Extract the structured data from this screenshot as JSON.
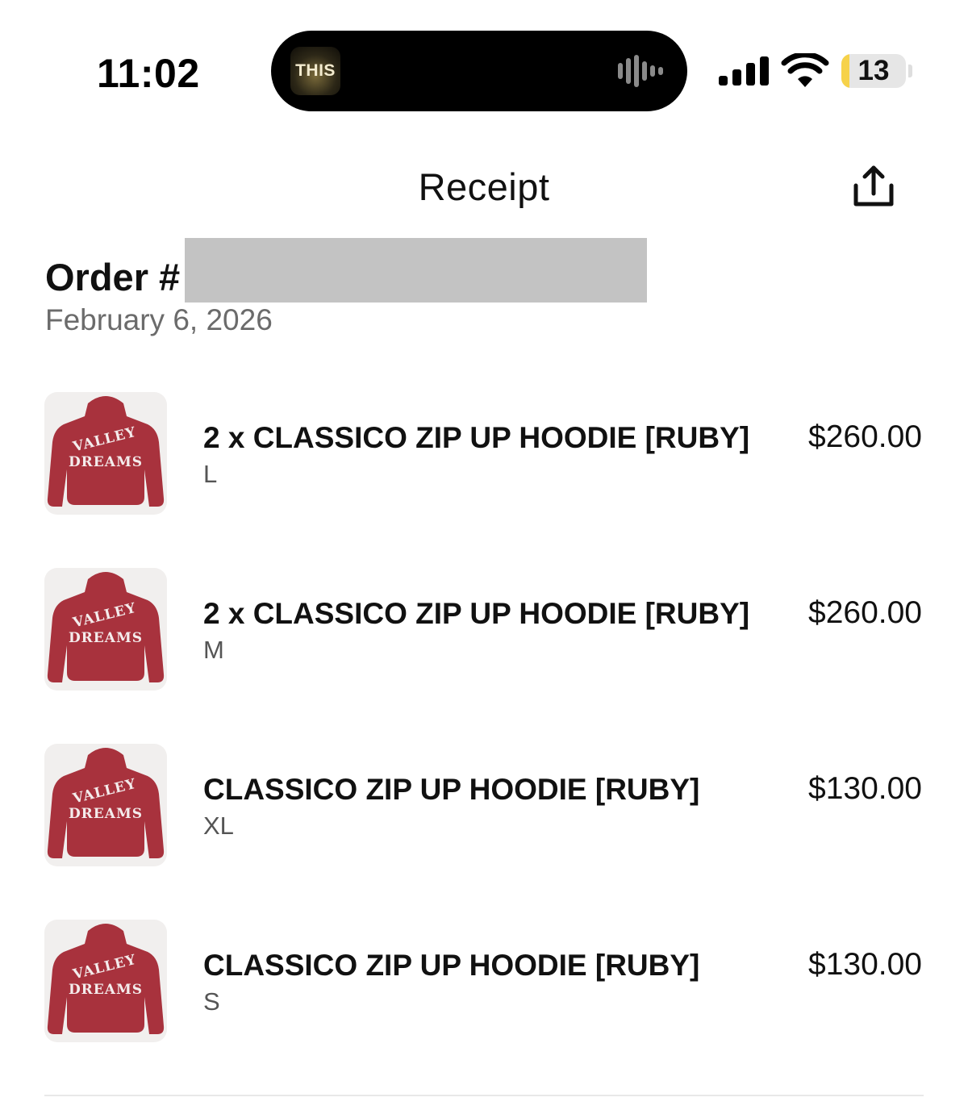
{
  "status_bar": {
    "time": "11:02",
    "island_app_label": "THIS",
    "battery_level": "13",
    "battery_fraction": 0.13,
    "icons": [
      "cellular-signal-icon",
      "wifi-icon",
      "battery-icon",
      "audio-waveform-icon"
    ]
  },
  "header": {
    "title": "Receipt",
    "share_icon": "share-icon"
  },
  "order": {
    "number_label": "Order #",
    "date": "February 6, 2026"
  },
  "items": [
    {
      "name": "2 x CLASSICO ZIP UP HOODIE [RUBY]",
      "size": "L",
      "price": "$260.00",
      "graphic_line1": "VALLEY",
      "graphic_line2": "DREAMS"
    },
    {
      "name": "2 x CLASSICO ZIP UP HOODIE [RUBY]",
      "size": "M",
      "price": "$260.00",
      "graphic_line1": "VALLEY",
      "graphic_line2": "DREAMS"
    },
    {
      "name": "CLASSICO ZIP UP HOODIE [RUBY]",
      "size": "XL",
      "price": "$130.00",
      "graphic_line1": "VALLEY",
      "graphic_line2": "DREAMS"
    },
    {
      "name": "CLASSICO ZIP UP HOODIE [RUBY]",
      "size": "S",
      "price": "$130.00",
      "graphic_line1": "VALLEY",
      "graphic_line2": "DREAMS"
    }
  ],
  "colors": {
    "hoodie_ruby": "#a8323d",
    "text_primary": "#111111",
    "text_secondary": "#6b6b6b",
    "redaction": "#c3c3c3",
    "battery_fill": "#f6d24a"
  }
}
